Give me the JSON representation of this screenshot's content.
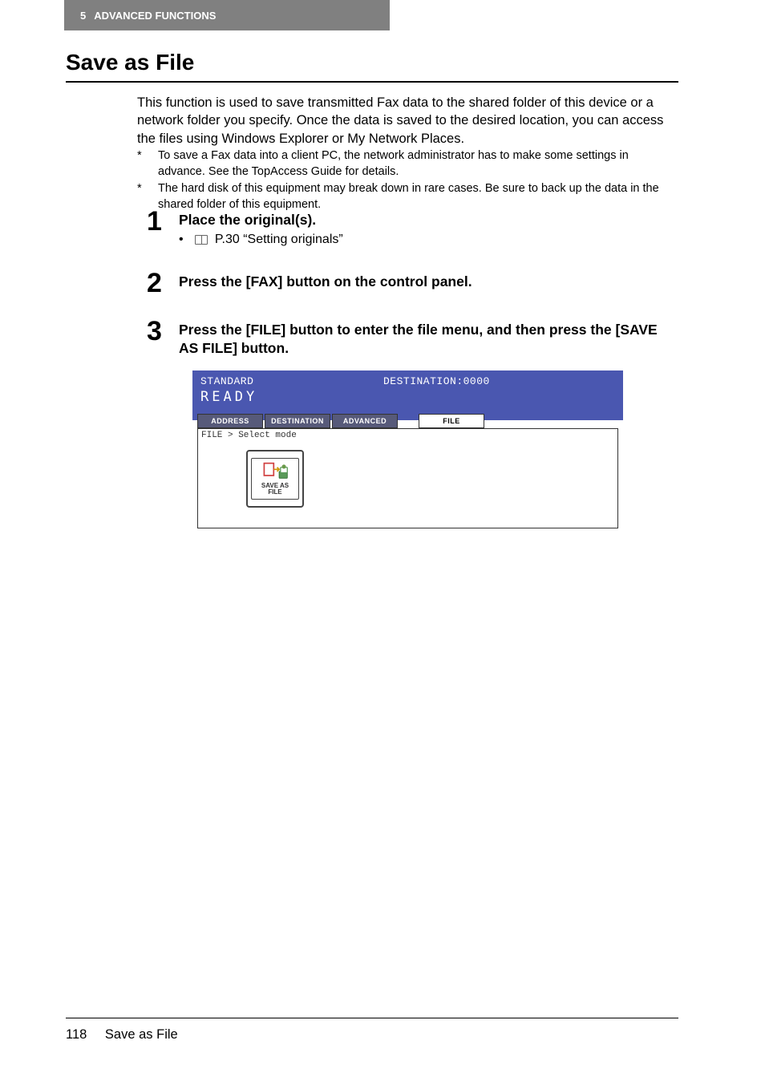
{
  "header": {
    "chapter_num": "5",
    "chapter_title": "ADVANCED FUNCTIONS"
  },
  "title": "Save as File",
  "intro": "This function is used to save transmitted Fax data to the shared folder of this device or a network folder you specify. Once the data is saved to the desired location, you can access the files using Windows Explorer or My Network Places.",
  "notes": [
    "To save a Fax data into a client PC, the network administrator has to make some settings in advance. See the TopAccess Guide for details.",
    "The hard disk of this equipment may break down in rare cases. Be sure to back up the data in the shared folder of this equipment."
  ],
  "steps": {
    "s1": {
      "num": "1",
      "title": "Place the original(s).",
      "bullet_ref": "P.30 “Setting originals”"
    },
    "s2": {
      "num": "2",
      "title": "Press the [FAX] button on the control panel."
    },
    "s3": {
      "num": "3",
      "title": "Press the [FILE] button to enter the file menu, and then press the [SAVE AS FILE] button."
    }
  },
  "panel": {
    "standard": "STANDARD",
    "destination": "DESTINATION:0000",
    "ready": "READY",
    "tabs": {
      "address": "ADDRESS",
      "dest": "DESTINATION",
      "adv": "ADVANCED",
      "file": "FILE"
    },
    "breadcrumb": "FILE > Select mode",
    "save_label_1": "SAVE AS",
    "save_label_2": "FILE"
  },
  "footer": {
    "page": "118",
    "title": "Save as File"
  }
}
